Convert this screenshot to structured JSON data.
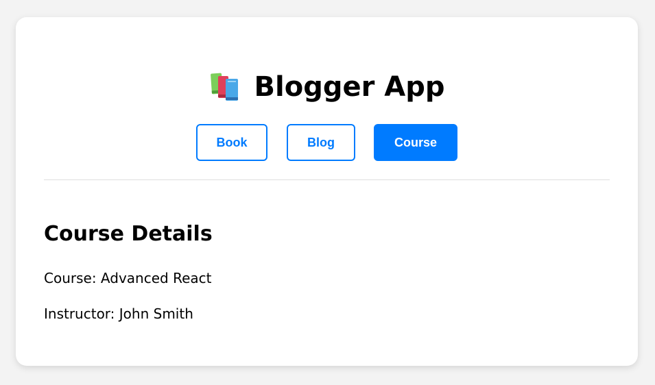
{
  "app": {
    "title": "Blogger App",
    "logo_icon": "books-icon"
  },
  "nav": {
    "items": [
      {
        "label": "Book",
        "active": false
      },
      {
        "label": "Blog",
        "active": false
      },
      {
        "label": "Course",
        "active": true
      }
    ],
    "accent_color": "#007bff"
  },
  "content": {
    "heading": "Course Details",
    "course_line": "Course: Advanced React",
    "instructor_line": "Instructor: John Smith"
  }
}
